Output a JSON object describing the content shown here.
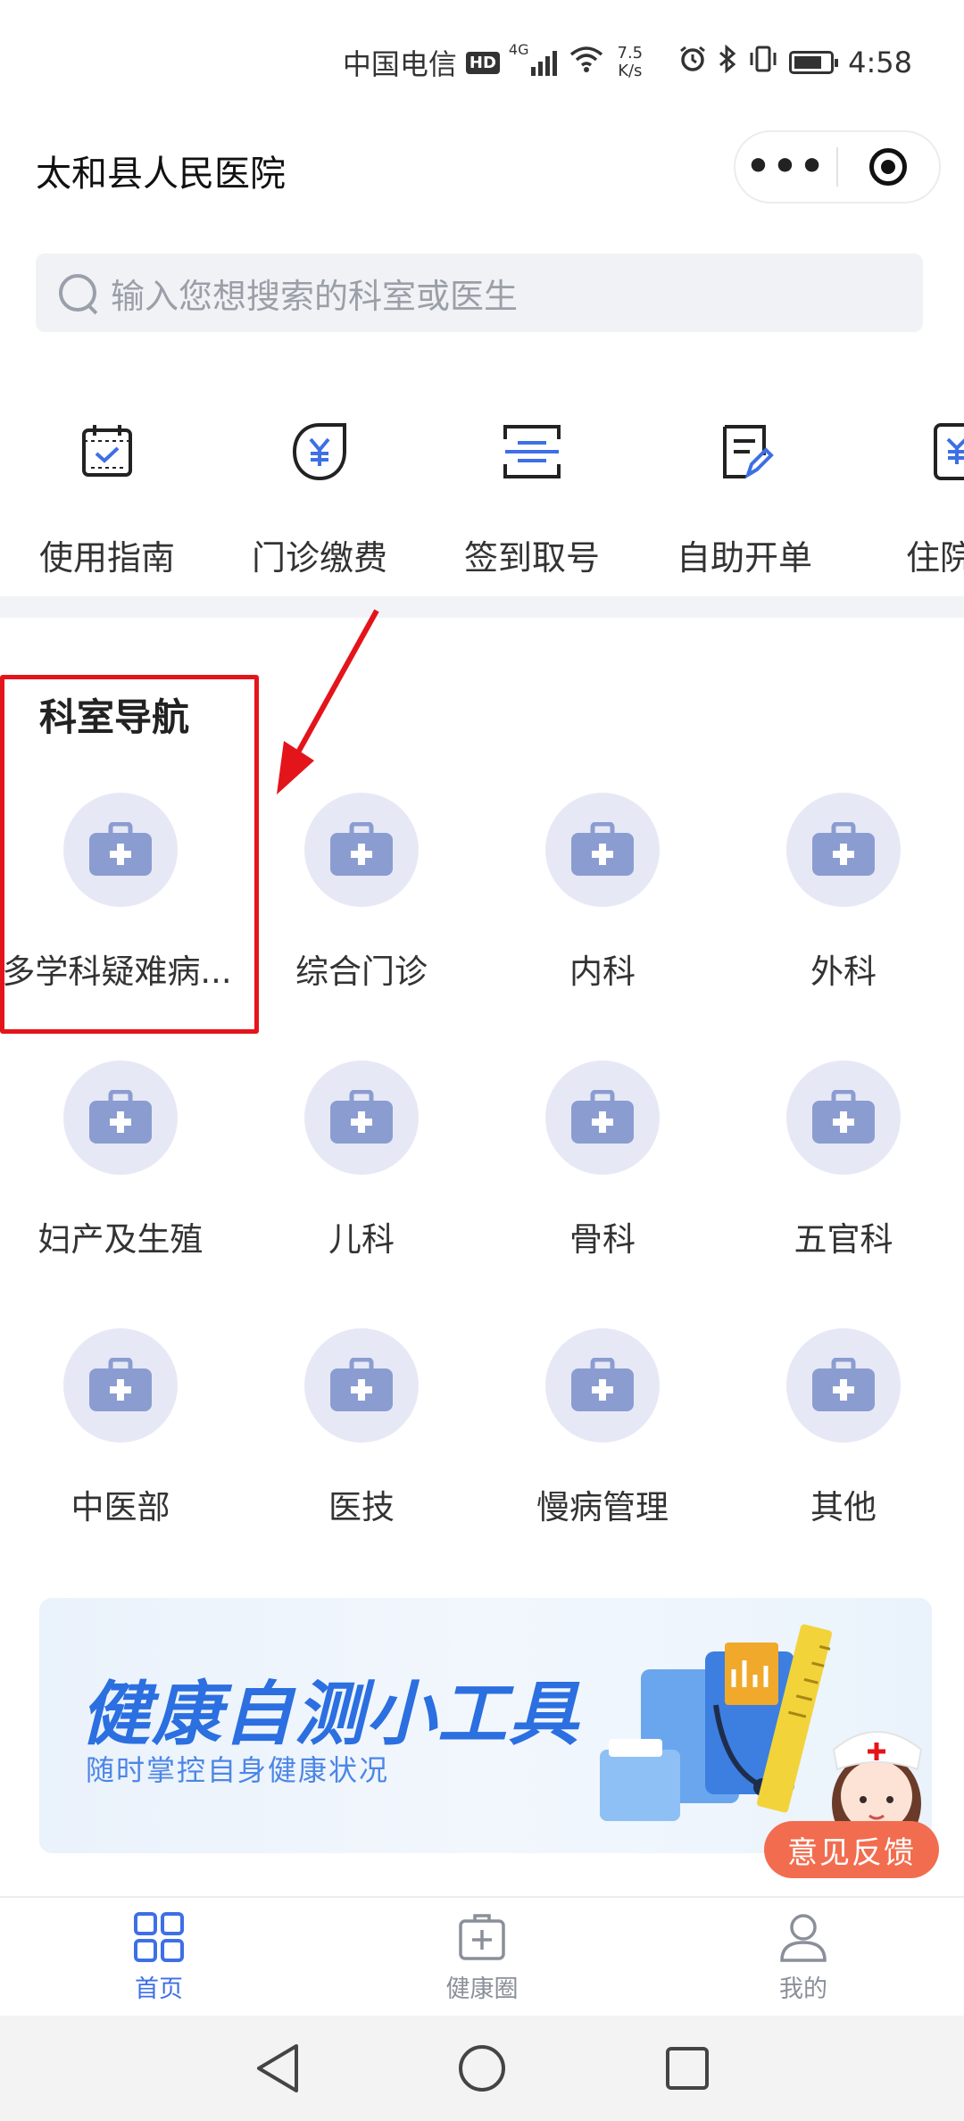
{
  "status_bar": {
    "carrier": "中国电信",
    "hd": "HD",
    "network": "4G",
    "speed_value": "7.5",
    "speed_unit": "K/s",
    "time": "4:58"
  },
  "header": {
    "title": "太和县人民医院",
    "more_label": "•••"
  },
  "search": {
    "placeholder": "输入您想搜索的科室或医生"
  },
  "quick_nav": [
    {
      "label": "使用指南",
      "icon": "calendar-check-icon"
    },
    {
      "label": "门诊缴费",
      "icon": "yuan-shield-icon"
    },
    {
      "label": "签到取号",
      "icon": "scan-icon"
    },
    {
      "label": "自助开单",
      "icon": "edit-document-icon"
    },
    {
      "label": "住院费",
      "icon": "yuan-document-icon"
    }
  ],
  "departments": {
    "title": "科室导航",
    "items": [
      {
        "label": "多学科疑难病..."
      },
      {
        "label": "综合门诊"
      },
      {
        "label": "内科"
      },
      {
        "label": "外科"
      },
      {
        "label": "妇产及生殖"
      },
      {
        "label": "儿科"
      },
      {
        "label": "骨科"
      },
      {
        "label": "五官科"
      },
      {
        "label": "中医部"
      },
      {
        "label": "医技"
      },
      {
        "label": "慢病管理"
      },
      {
        "label": "其他"
      }
    ]
  },
  "banner": {
    "title": "健康自测小工具",
    "subtitle": "随时掌控自身健康状况"
  },
  "feedback": {
    "label": "意见反馈"
  },
  "tab_bar": [
    {
      "label": "首页",
      "icon": "grid-home-icon",
      "active": true
    },
    {
      "label": "健康圈",
      "icon": "medical-kit-icon",
      "active": false
    },
    {
      "label": "我的",
      "icon": "user-icon",
      "active": false
    }
  ],
  "colors": {
    "accent": "#3d6fe6",
    "dept_icon": "#8b9cd1",
    "dept_circle": "#e6e9f5",
    "highlight": "#e4141b",
    "feedback": "#f26d4f"
  }
}
